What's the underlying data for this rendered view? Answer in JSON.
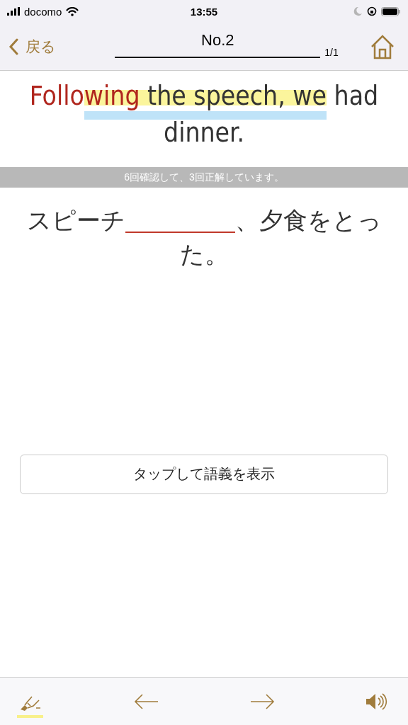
{
  "status_bar": {
    "carrier": "docomo",
    "time": "13:55"
  },
  "nav": {
    "back": "戻る",
    "title": "No.2",
    "counter": "1/1"
  },
  "sentence": [
    {
      "text": "Follo",
      "kind": "target",
      "highlighted": false
    },
    {
      "text": "wing",
      "kind": "target",
      "highlighted": true
    },
    {
      "text": " the speech, we",
      "kind": "plain",
      "highlighted": true
    },
    {
      "text": " had dinner.",
      "kind": "plain",
      "highlighted": false
    }
  ],
  "progress_note": "6回確認して、3回正解しています。",
  "translation": {
    "before": "スピーチ",
    "after": "、夕食をとった。"
  },
  "reveal_button": "タップして語義を表示",
  "toolbar": {
    "highlighter_on": true
  }
}
